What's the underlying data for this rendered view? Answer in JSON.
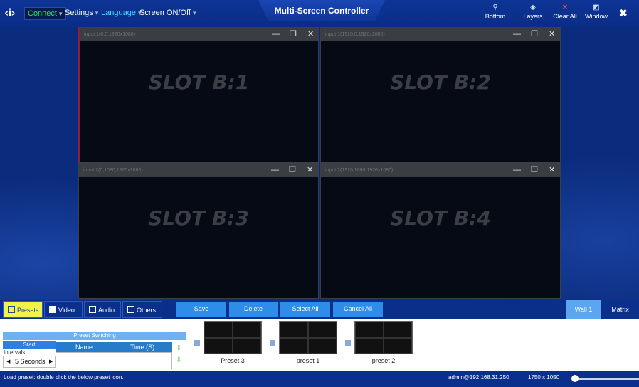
{
  "app": {
    "title": "Multi-Screen Controller",
    "logo_icon": "diamond-logo-icon",
    "logo_glyph": "‹i›"
  },
  "menu": {
    "connect": "Connect",
    "settings": "Settings",
    "language": "Language",
    "screen": "Screen ON/Off"
  },
  "toolbar": {
    "bottom": "Bottom",
    "layers": "Layers",
    "clear_all": "Clear All",
    "window": "Window",
    "close_glyph": "✖"
  },
  "slots": [
    {
      "label": "SLOT B:1",
      "source": "input 1(0,0,1920x1080)"
    },
    {
      "label": "SLOT B:2",
      "source": "input 1(1920,0,1920x1080)"
    },
    {
      "label": "SLOT B:3",
      "source": "input 2(0,1080,1920x1080)"
    },
    {
      "label": "SLOT B:4",
      "source": "input 2(1920,1080,1920x1080)"
    }
  ],
  "tabs": {
    "presets": "Presets",
    "video": "Video",
    "audio": "Audio",
    "others": "Others"
  },
  "actions": {
    "save": "Save",
    "delete": "Delete",
    "select_all": "Select All",
    "cancel_all": "Cancel All"
  },
  "walls": {
    "wall1": "Wall 1",
    "matrix": "Matrix"
  },
  "preset_switching": {
    "title": "Preset Switching",
    "start": "Start",
    "intervals_label": "Intervals:",
    "interval_value": "5 Seconds",
    "col_name": "Name",
    "col_time": "Time (S)"
  },
  "presets": [
    {
      "name": "Preset 3"
    },
    {
      "name": "preset 1"
    },
    {
      "name": "preset 2"
    }
  ],
  "status": {
    "hint": "Load preset: double click the below preset icon.",
    "user": "admin@192.168.31.250",
    "resolution": "1750 x 1050"
  },
  "colors": {
    "brand_blue": "#0b2f8c",
    "connect_green": "#33e04a",
    "active_tab_yellow": "#f2f24a",
    "action_blue": "#2d8de8",
    "wall_active": "#5aa6f0"
  }
}
